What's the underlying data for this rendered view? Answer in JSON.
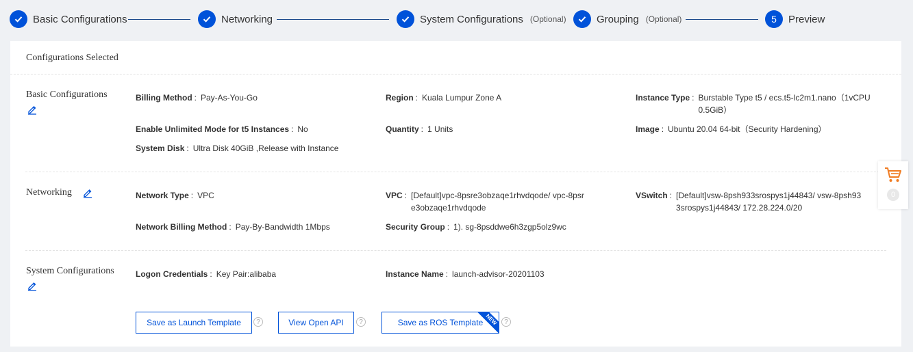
{
  "stepper": {
    "steps": [
      {
        "label": "Basic Configurations",
        "optional": "",
        "state": "done"
      },
      {
        "label": "Networking",
        "optional": "",
        "state": "done"
      },
      {
        "label": "System Configurations",
        "optional": "(Optional)",
        "state": "done"
      },
      {
        "label": "Grouping",
        "optional": "(Optional)",
        "state": "done"
      },
      {
        "label": "Preview",
        "number": "5",
        "state": "active"
      }
    ]
  },
  "card": {
    "title": "Configurations Selected",
    "sections": {
      "basic": {
        "title": "Basic Configurations",
        "fields": [
          {
            "key": "Billing Method",
            "value": "Pay-As-You-Go"
          },
          {
            "key": "Region",
            "value": "Kuala Lumpur Zone A"
          },
          {
            "key": "Instance Type",
            "value": "Burstable Type t5 / ecs.t5-lc2m1.nano（1vCPU 0.5GiB）"
          },
          {
            "key": "Enable Unlimited Mode for t5 Instances",
            "value": "No"
          },
          {
            "key": "Quantity",
            "value": "1 Units"
          },
          {
            "key": "Image",
            "value": "Ubuntu 20.04 64-bit（Security Hardening）"
          },
          {
            "key": "System Disk",
            "value": "Ultra Disk 40GiB ,Release with Instance"
          }
        ]
      },
      "networking": {
        "title": "Networking",
        "fields": [
          {
            "key": "Network Type",
            "value": "VPC"
          },
          {
            "key": "VPC",
            "value": "[Default]vpc-8psre3obzaqe1rhvdqode/ vpc-8psre3obzaqe1rhvdqode"
          },
          {
            "key": "VSwitch",
            "value": "[Default]vsw-8psh933srospys1j44843/ vsw-8psh933srospys1j44843/ 172.28.224.0/20"
          },
          {
            "key": "Network Billing Method",
            "value": "Pay-By-Bandwidth 1Mbps"
          },
          {
            "key": "Security Group",
            "value": "1). sg-8psddwe6h3zgp5olz9wc"
          }
        ]
      },
      "system": {
        "title": "System Configurations",
        "fields": [
          {
            "key": "Logon Credentials",
            "value": "Key Pair:alibaba"
          },
          {
            "key": "Instance Name",
            "value": "launch-advisor-20201103"
          }
        ]
      }
    },
    "separator": ":",
    "buttons": {
      "launch_template": "Save as Launch Template",
      "open_api": "View Open API",
      "ros_template": "Save as ROS Template",
      "new_badge": "NEW",
      "help": "?"
    }
  },
  "cart": {
    "count": "0"
  },
  "colors": {
    "accent": "#0052d9",
    "cart": "#f07c22",
    "background": "#eff1f4"
  }
}
